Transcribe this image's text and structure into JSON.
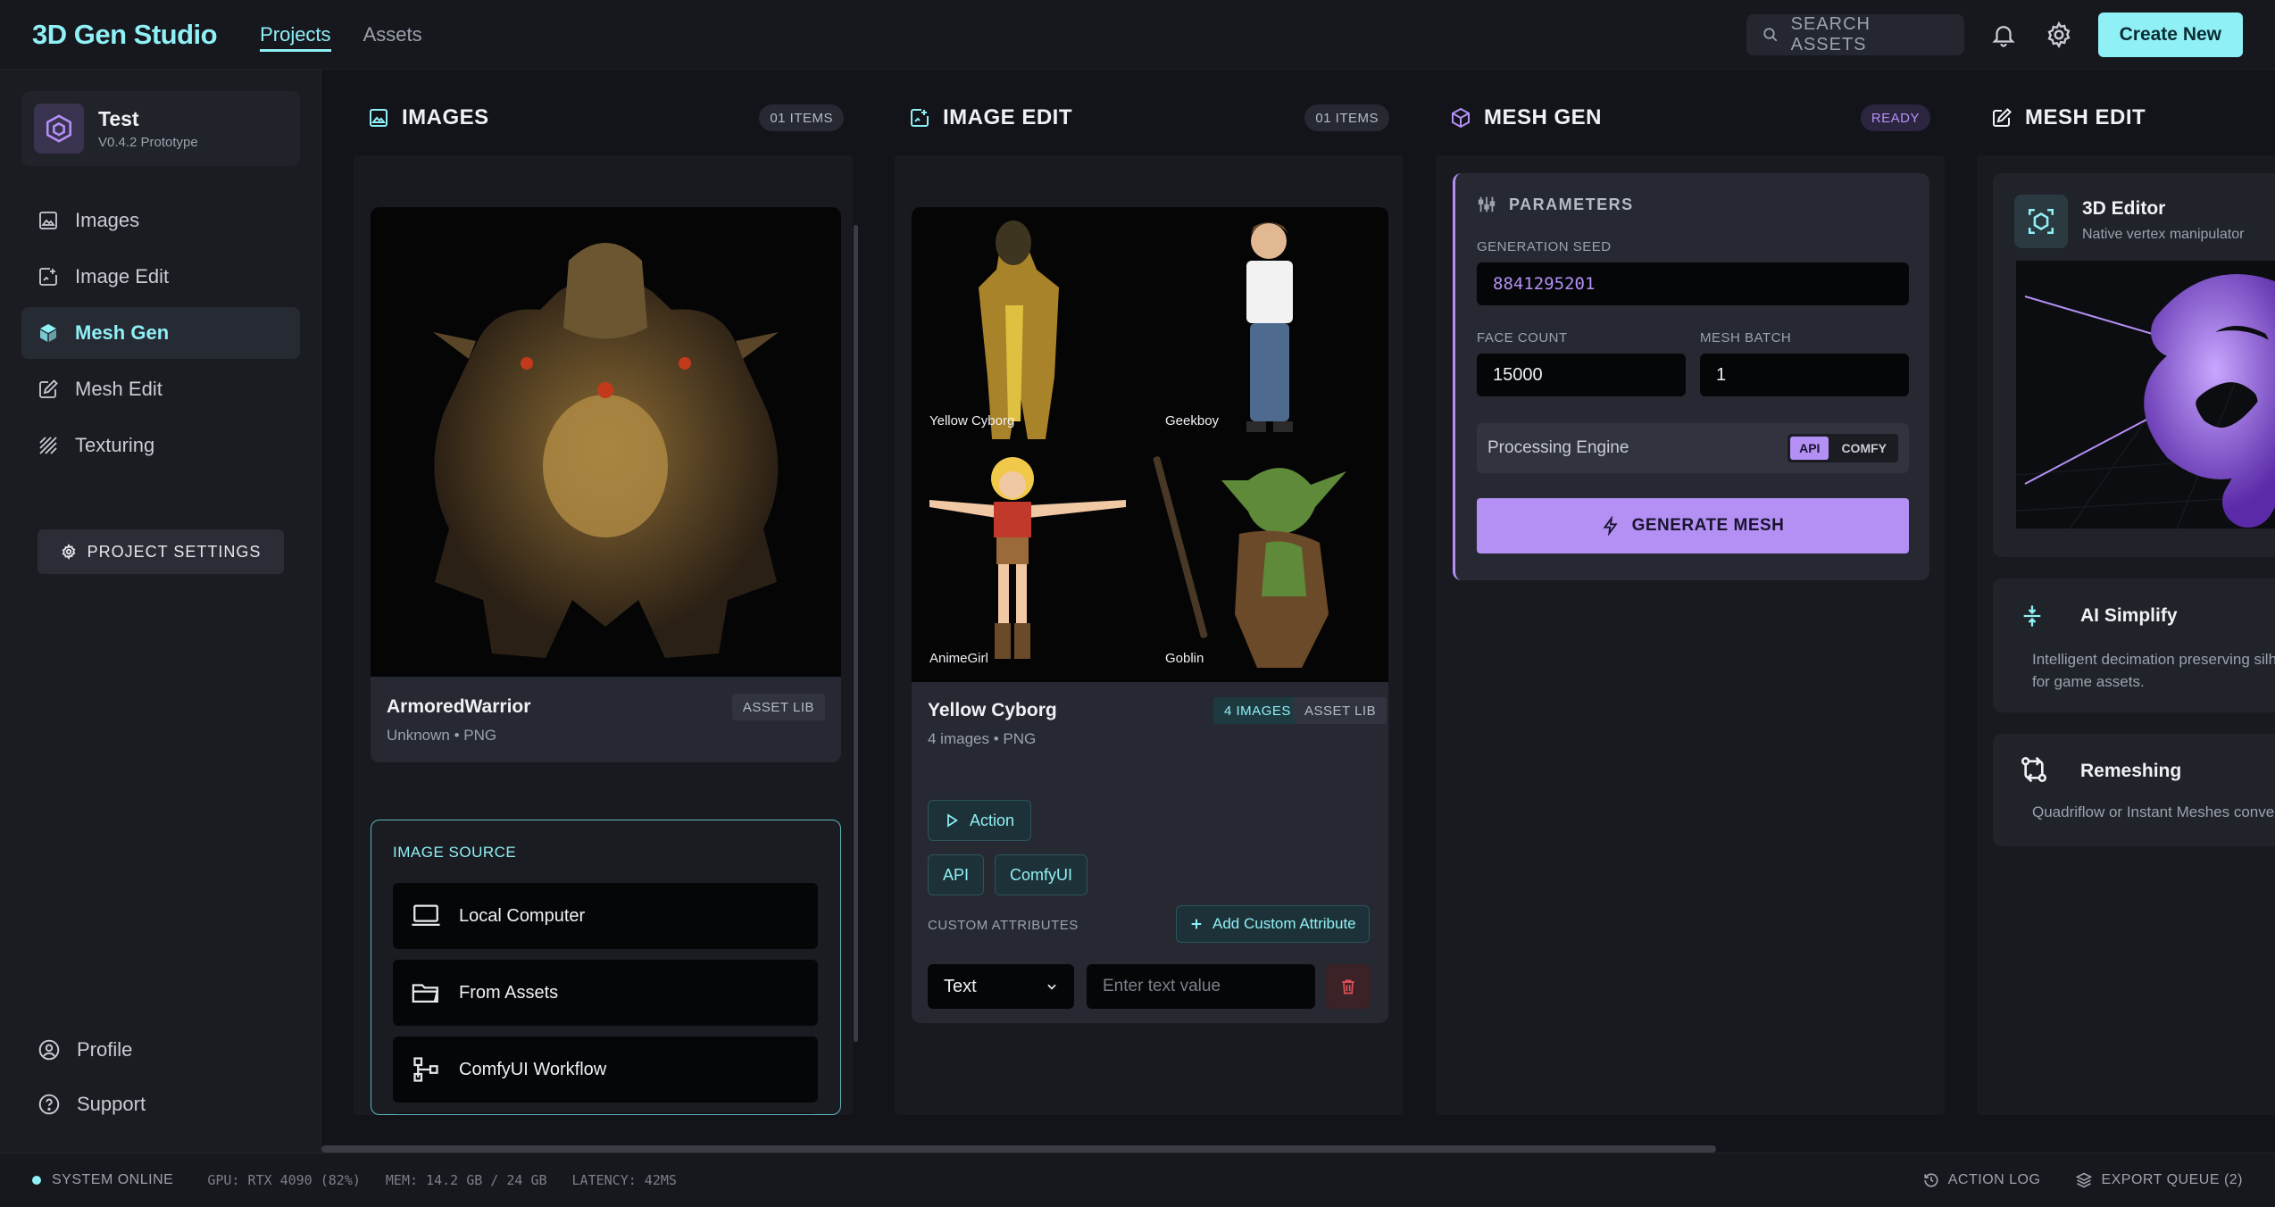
{
  "app": {
    "title": "3D Gen Studio"
  },
  "topnav": {
    "projects": "Projects",
    "assets": "Assets"
  },
  "search": {
    "placeholder": "SEARCH ASSETS"
  },
  "header": {
    "create_label": "Create New"
  },
  "project": {
    "name": "Test",
    "version": "V0.4.2 Prototype"
  },
  "sidebar": {
    "items": [
      {
        "label": "Images",
        "icon": "image-icon"
      },
      {
        "label": "Image Edit",
        "icon": "image-edit-icon"
      },
      {
        "label": "Mesh Gen",
        "icon": "cube-icon",
        "active": true
      },
      {
        "label": "Mesh Edit",
        "icon": "edit-icon"
      },
      {
        "label": "Texturing",
        "icon": "texture-icon"
      }
    ],
    "project_settings": "PROJECT SETTINGS",
    "profile": "Profile",
    "support": "Support"
  },
  "images_col": {
    "title": "IMAGES",
    "count": "01 ITEMS",
    "asset": {
      "name": "ArmoredWarrior",
      "meta": "Unknown • PNG",
      "badge": "ASSET LIB"
    },
    "source": {
      "label": "IMAGE SOURCE",
      "local": "Local Computer",
      "assets": "From Assets",
      "comfy": "ComfyUI Workflow"
    }
  },
  "edit_col": {
    "title": "IMAGE EDIT",
    "count": "01 ITEMS",
    "thumbs": [
      "Yellow Cyborg",
      "Geekboy",
      "AnimeGirl",
      "Goblin"
    ],
    "asset": {
      "name": "Yellow Cyborg",
      "meta": "4 images • PNG",
      "images_badge": "4 IMAGES",
      "lib_badge": "ASSET LIB"
    },
    "action": "Action",
    "api": "API",
    "comfy": "ComfyUI",
    "custom_label": "CUSTOM ATTRIBUTES",
    "add_custom": "Add Custom Attribute",
    "attr_type": "Text",
    "attr_placeholder": "Enter text value"
  },
  "mesh_col": {
    "title": "MESH GEN",
    "status": "READY",
    "params_title": "PARAMETERS",
    "seed_label": "GENERATION SEED",
    "seed_value": "8841295201",
    "face_label": "FACE COUNT",
    "face_value": "15000",
    "batch_label": "MESH BATCH",
    "batch_value": "1",
    "engine_label": "Processing Engine",
    "engine_api": "API",
    "engine_comfy": "COMFY",
    "generate": "GENERATE MESH"
  },
  "meshedit_col": {
    "title": "MESH EDIT",
    "editor_title": "3D Editor",
    "editor_sub": "Native vertex manipulator",
    "simplify_title": "AI Simplify",
    "simplify_desc": "Intelligent decimation preserving silh… for game assets.",
    "simplify_line1": "Intelligent decimation preserving silh",
    "simplify_line2": "for game assets.",
    "remesh_title": "Remeshing",
    "remesh_desc": "Quadriflow or Instant Meshes conver"
  },
  "footer": {
    "status": "SYSTEM ONLINE",
    "gpu": "GPU: RTX 4090 (82%)",
    "mem": "MEM: 14.2 GB / 24 GB",
    "latency": "LATENCY: 42MS",
    "action_log": "ACTION LOG",
    "export_queue": "EXPORT QUEUE (2)"
  },
  "colors": {
    "accent": "#8ff0f6",
    "purple": "#b490f5",
    "bg": "#12141a"
  }
}
